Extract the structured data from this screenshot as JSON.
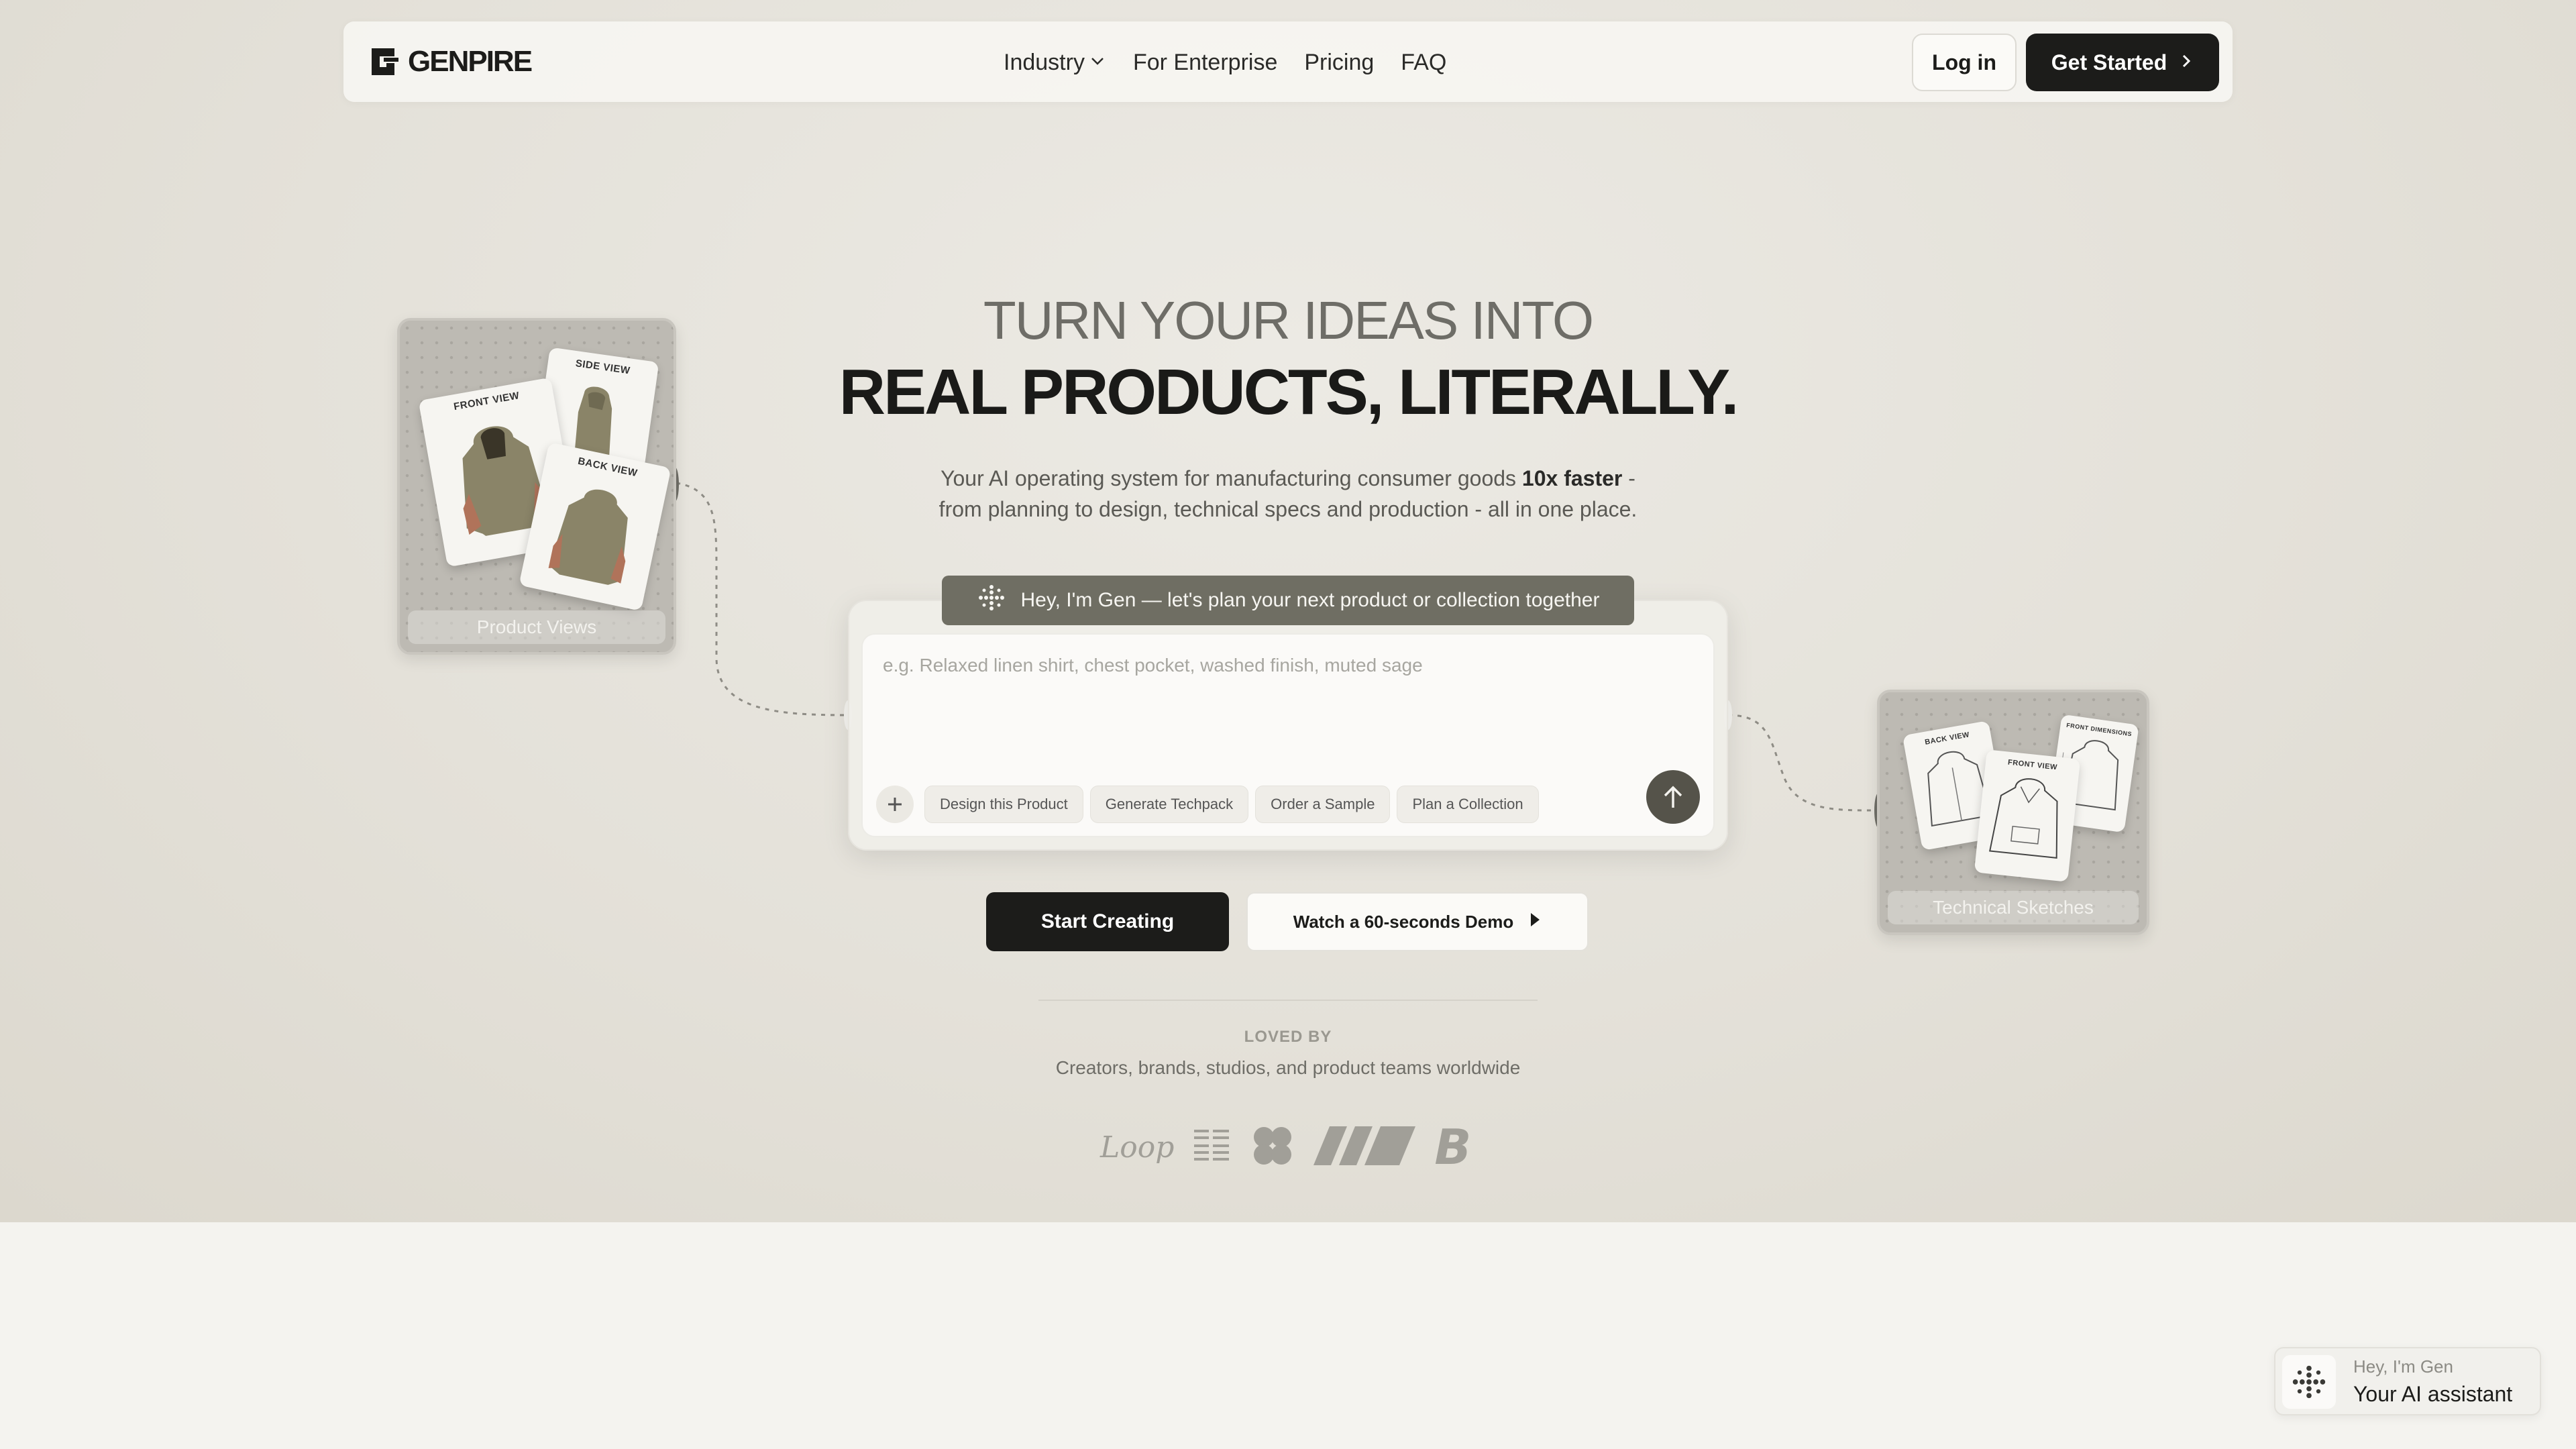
{
  "nav": {
    "logo_text": "GENPIRE",
    "links": [
      "Industry",
      "For Enterprise",
      "Pricing",
      "FAQ"
    ],
    "login_label": "Log in",
    "get_started_label": "Get Started"
  },
  "hero": {
    "headline_line1": "TURN YOUR IDEAS INTO",
    "headline_line2": "REAL PRODUCTS, LITERALLY.",
    "sub_line1_pre": "Your AI operating system for manufacturing consumer goods ",
    "sub_line1_bold": "10x faster",
    "sub_line1_post": " -",
    "sub_line2": "from planning to design, technical specs and production - all in one place."
  },
  "cards": {
    "left": {
      "label": "Product Views",
      "front_view": "FRONT VIEW",
      "side_view": "SIDE VIEW",
      "back_view": "BACK VIEW"
    },
    "right": {
      "label": "Technical Sketches",
      "back_view": "BACK VIEW",
      "front_view": "FRONT VIEW",
      "front_dimensions": "FRONT DIMENSIONS"
    }
  },
  "prompt": {
    "gen_banner": "Hey, I'm Gen — let's plan your next product or collection together",
    "placeholder": "e.g. Relaxed linen shirt, chest pocket, washed finish, muted sage",
    "chips": [
      "Design this Product",
      "Generate Techpack",
      "Order a Sample",
      "Plan a Collection"
    ]
  },
  "cta": {
    "primary": "Start Creating",
    "secondary": "Watch a 60-seconds Demo"
  },
  "social_proof": {
    "title": "LOVED BY",
    "subtitle": "Creators, brands, studios, and product teams worldwide",
    "logos": [
      "Loop",
      "grid-logo",
      "clover-logo",
      "stripes-logo",
      "B"
    ]
  },
  "chat_widget": {
    "line1": "Hey, I'm Gen",
    "line2": "Your AI assistant"
  },
  "colors": {
    "accent_dark": "#1c1c1a",
    "olive": "#6f6e63",
    "hoodie": "#8a8468"
  }
}
